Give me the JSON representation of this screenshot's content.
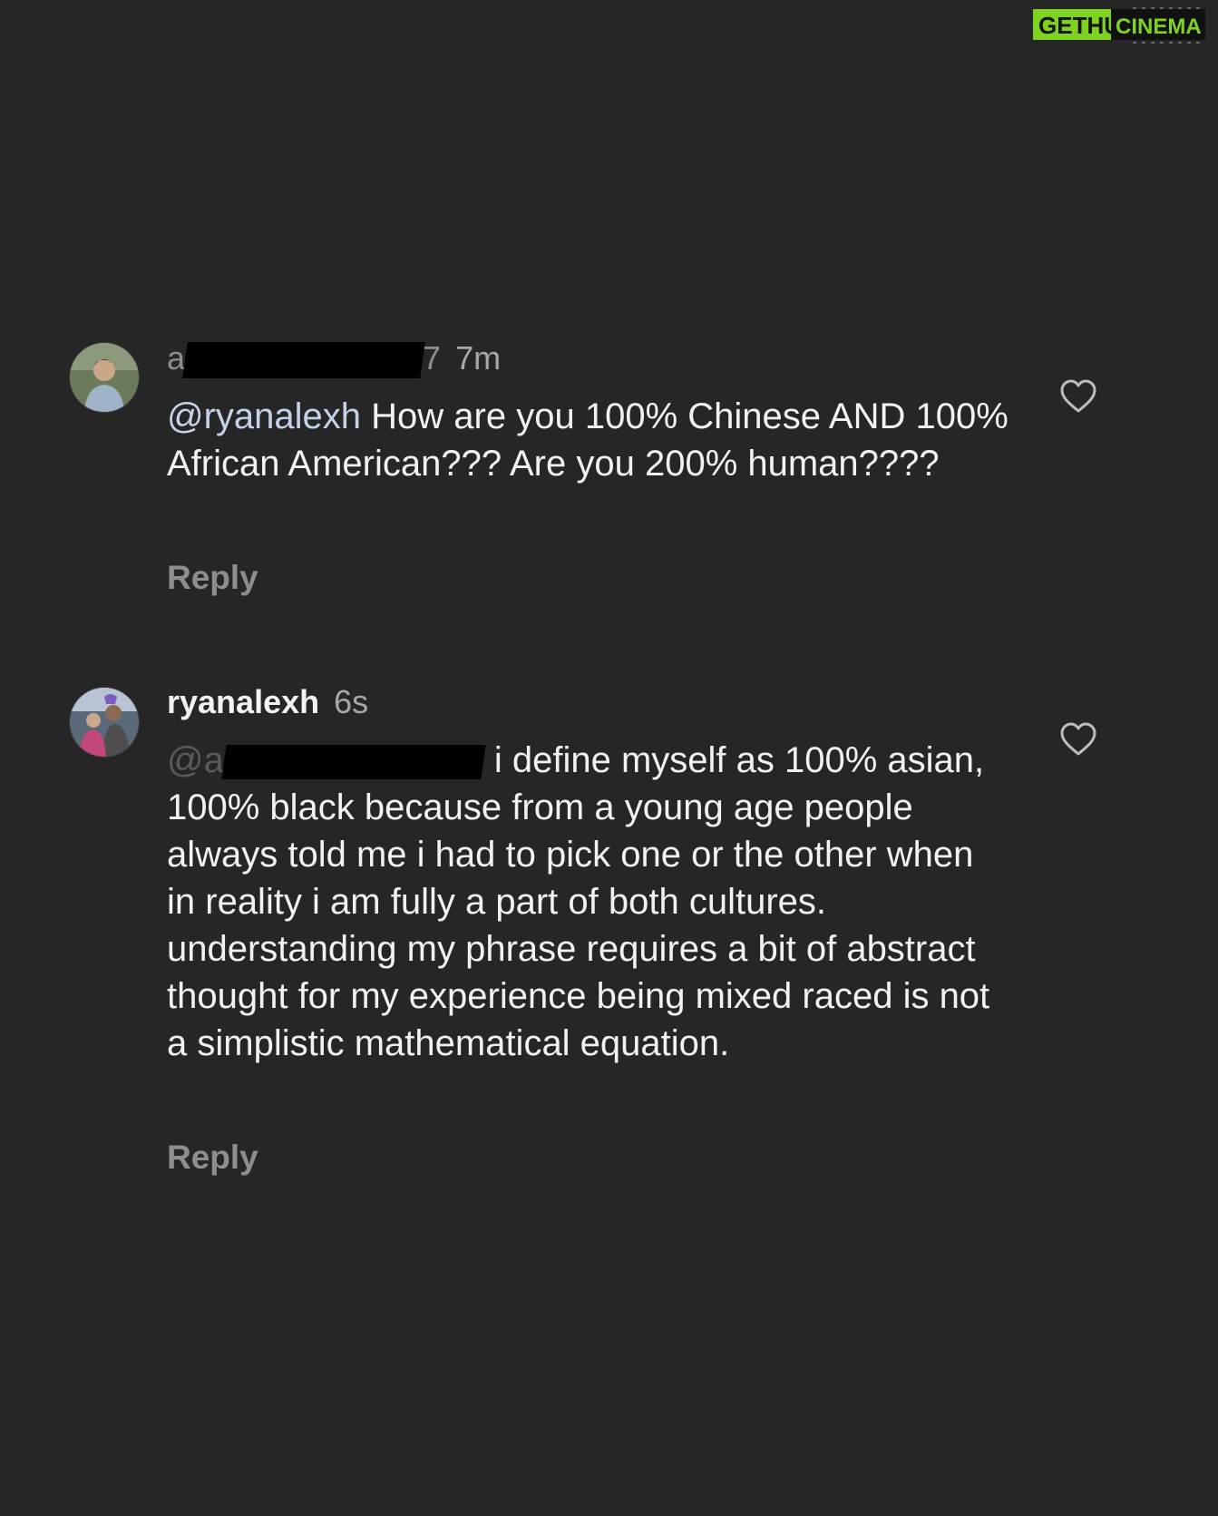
{
  "watermark": {
    "part1": "GETHU",
    "part2": "CINEMA"
  },
  "comments": [
    {
      "username_visible": "a",
      "username_tail": "7",
      "time": "7m",
      "mention": "@ryanalexh",
      "text": "How are you 100% Chinese AND 100% African American??? Are you 200% human????",
      "reply_label": "Reply"
    },
    {
      "username": "ryanalexh",
      "time": "6s",
      "mention_visible": "@a",
      "text": "i define myself as 100% asian, 100% black because from a young age people always told me i had to pick one or the other when in reality i am fully a part of both cultures. understanding my phrase requires a bit of abstract thought for my experience being mixed raced is not a simplistic mathematical equation.",
      "reply_label": "Reply"
    }
  ],
  "icons": {
    "like": "heart-outline-icon",
    "avatar1": "user-avatar-photo",
    "avatar2": "user-avatar-photo"
  },
  "colors": {
    "background": "#262626",
    "text": "#f2f2f2",
    "secondary": "#8e8e8e",
    "mention": "#c5d3e8",
    "watermark_green": "#7ed321"
  }
}
